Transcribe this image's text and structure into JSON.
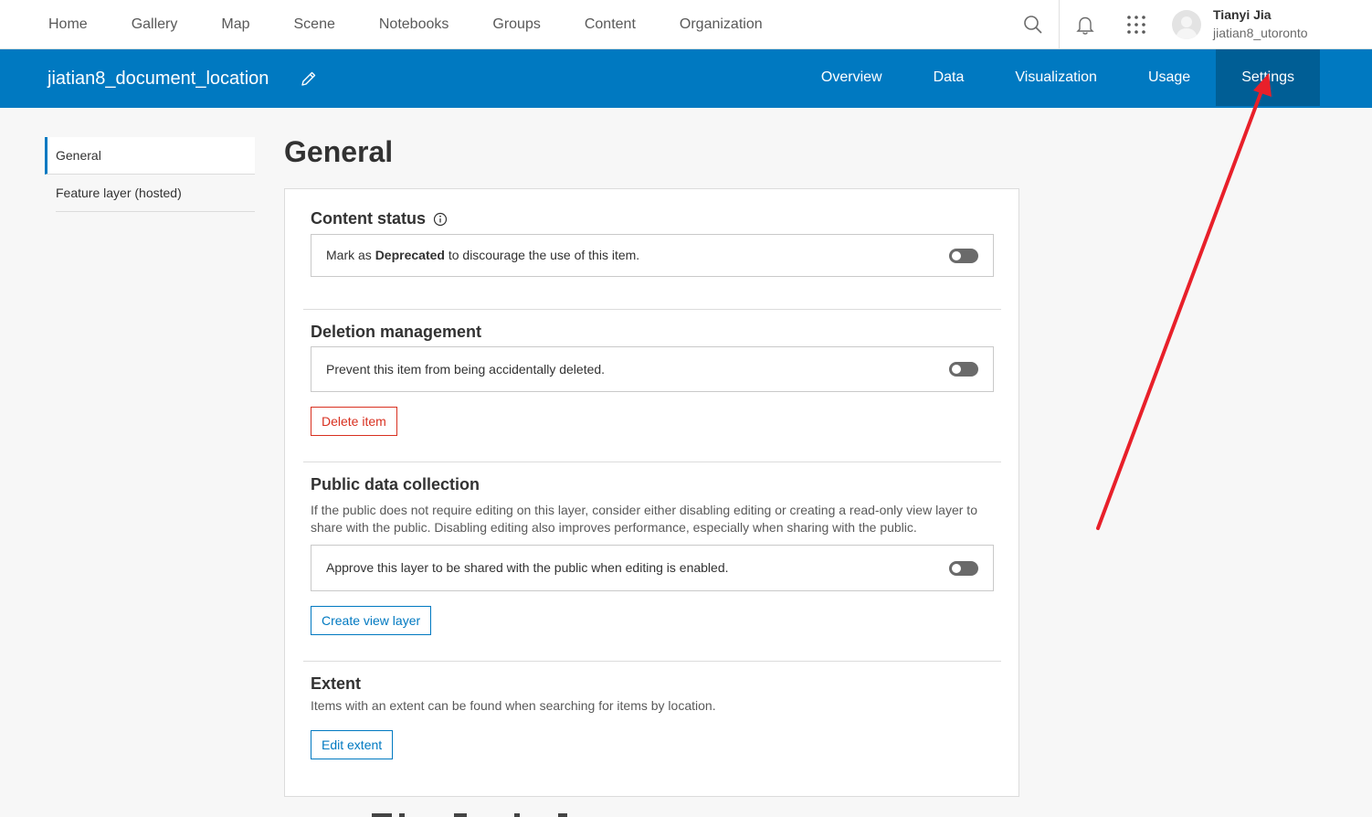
{
  "topnav": {
    "links": [
      "Home",
      "Gallery",
      "Map",
      "Scene",
      "Notebooks",
      "Groups",
      "Content",
      "Organization"
    ],
    "search_icon": "search-icon",
    "notifications_icon": "bell-icon",
    "apps_icon": "app-launcher-icon",
    "user": {
      "full_name": "Tianyi Jia",
      "username": "jiatian8_utoronto"
    }
  },
  "item_header": {
    "title": "jiatian8_document_location",
    "edit_icon": "pencil-icon",
    "tabs": [
      "Overview",
      "Data",
      "Visualization",
      "Usage",
      "Settings"
    ],
    "active_tab": "Settings",
    "bg_color": "#0079c1"
  },
  "sidenav": {
    "items": [
      "General",
      "Feature layer (hosted)"
    ],
    "active": "General"
  },
  "main": {
    "heading": "General",
    "content_status": {
      "title": "Content status",
      "info_icon": "info-icon",
      "label_prefix": "Mark as ",
      "label_bold": "Deprecated",
      "label_suffix": " to discourage the use of this item.",
      "toggle_on": false
    },
    "deletion": {
      "title": "Deletion management",
      "label": "Prevent this item from being accidentally deleted.",
      "toggle_on": false,
      "delete_button": "Delete item"
    },
    "public_data": {
      "title": "Public data collection",
      "description": "If the public does not require editing on this layer, consider either disabling editing or creating a read-only view layer to share with the public. Disabling editing also improves performance, especially when sharing with the public.",
      "label": "Approve this layer to be shared with the public when editing is enabled.",
      "toggle_on": false,
      "create_button": "Create view layer"
    },
    "extent": {
      "title": "Extent",
      "description": "Items with an extent can be found when searching for items by location.",
      "edit_button": "Edit extent"
    }
  },
  "annotation": {
    "arrow_color": "#e8202a",
    "points_to": "Settings"
  }
}
